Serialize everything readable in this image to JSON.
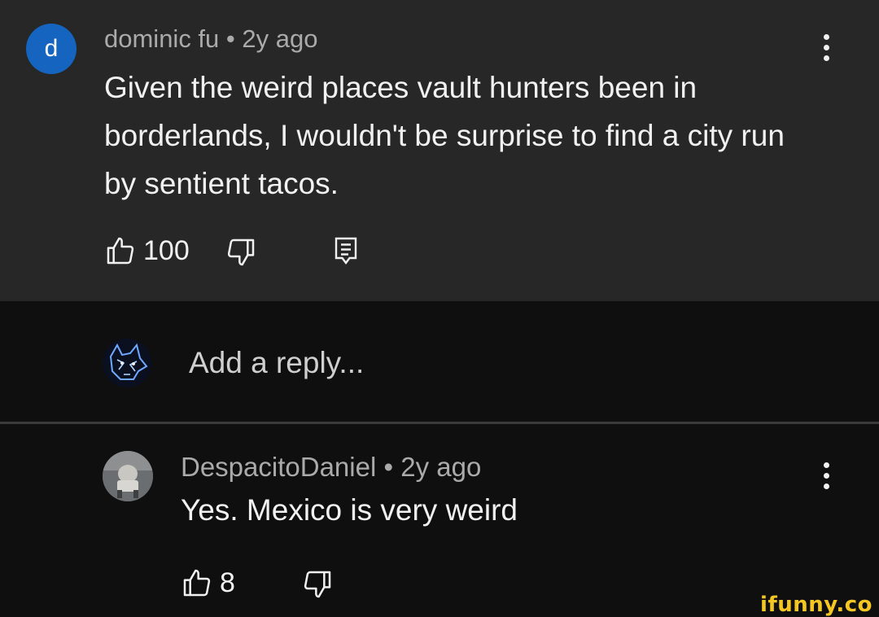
{
  "top_comment": {
    "avatar_letter": "d",
    "author": "dominic fu",
    "separator": "•",
    "age": "2y ago",
    "text": "Given the weird places vault hunters been in borderlands, I wouldn't be surprise to find a city run by sentient tacos.",
    "like_count": "100",
    "icons": [
      "thumbs-up-icon",
      "thumbs-down-icon",
      "reply-icon",
      "more-vert-icon"
    ]
  },
  "reply_input": {
    "placeholder": "Add a reply...",
    "avatar_icon": "wolf-avatar"
  },
  "reply": {
    "author": "DespacitoDaniel",
    "separator": "•",
    "age": "2y ago",
    "text": "Yes. Mexico is very weird",
    "like_count": "8"
  },
  "watermark": "ifunny.co",
  "colors": {
    "background": "#0f0f0f",
    "highlight_background": "#272727",
    "text": "#f1f1f1",
    "meta": "#aaaaaa",
    "avatar_blue": "#1565c0",
    "watermark": "#f3c623"
  }
}
